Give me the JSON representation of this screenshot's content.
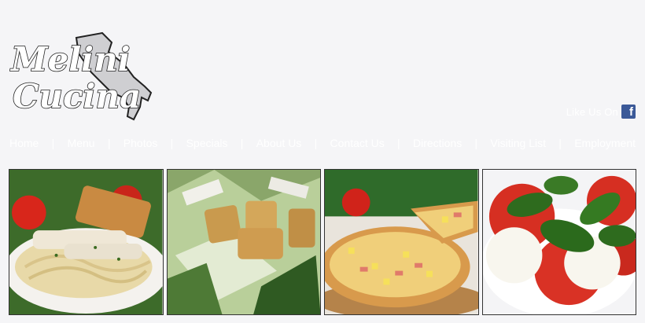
{
  "brand": {
    "line1": "Melini",
    "line2": "Cucina"
  },
  "social": {
    "label": "Like Us On",
    "icon": "facebook-icon"
  },
  "nav": {
    "items": [
      {
        "label": "Home"
      },
      {
        "label": "Menu"
      },
      {
        "label": "Photos"
      },
      {
        "label": "Specials"
      },
      {
        "label": "About Us"
      },
      {
        "label": "Contact Us"
      },
      {
        "label": "Directions"
      },
      {
        "label": "Visiting List"
      },
      {
        "label": "Employment"
      }
    ]
  },
  "gallery": [
    {
      "name": "photo-pasta-chicken"
    },
    {
      "name": "photo-caesar-salad"
    },
    {
      "name": "photo-hawaiian-pizza"
    },
    {
      "name": "photo-caprese-salad"
    }
  ],
  "colors": {
    "background": "#f5f5f7",
    "facebook": "#3b5998",
    "nav_text": "#ffffff"
  }
}
